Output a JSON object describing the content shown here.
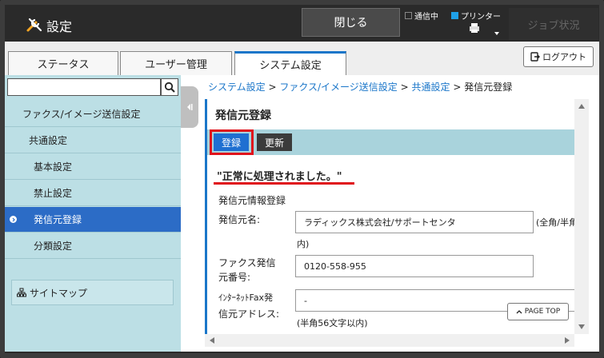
{
  "header": {
    "title": "設定",
    "close_label": "閉じる",
    "status_comm": "通信中",
    "status_printer": "プリンター",
    "job_status_label": "ジョブ状況"
  },
  "tabs": [
    {
      "label": "ステータス"
    },
    {
      "label": "ユーザー管理"
    },
    {
      "label": "システム設定"
    }
  ],
  "logout_label": "ログアウト",
  "sidebar": {
    "search_placeholder": "",
    "items": [
      {
        "label": "ファクス/イメージ送信設定"
      },
      {
        "label": "共通設定"
      },
      {
        "label": "基本設定"
      },
      {
        "label": "禁止設定"
      },
      {
        "label": "発信元登録"
      },
      {
        "label": "分類設定"
      }
    ],
    "sitemap_label": "サイトマップ"
  },
  "breadcrumb": {
    "items": [
      "システム設定",
      "ファクス/イメージ送信設定",
      "共通設定",
      "発信元登録"
    ],
    "separator": ">"
  },
  "panel": {
    "title": "発信元登録",
    "register_label": "登録",
    "update_label": "更新",
    "message": "\"正常に処理されました。\"",
    "section_title": "発信元情報登録",
    "fields": {
      "name_label": "発信元名:",
      "name_value": "ラディックス株式会社/サポートセンタ",
      "name_note": "(全角/半角",
      "name_note2": "内)",
      "fax_label_1": "ファクス発信",
      "fax_label_2": "元番号:",
      "fax_value": "0120-558-955",
      "ifax_label_1": "ｲﾝﾀｰﾈｯﾄFax発",
      "ifax_label_2": "信元アドレス:",
      "ifax_value": "-",
      "ifax_note": "(半角56文字以内)"
    },
    "page_top_label": "PAGE TOP"
  },
  "colors": {
    "accent_blue": "#1a76c9",
    "sidebar_bg": "#bcdfe5",
    "active_nav": "#2c6cc6",
    "highlight_red": "#e0121b"
  }
}
